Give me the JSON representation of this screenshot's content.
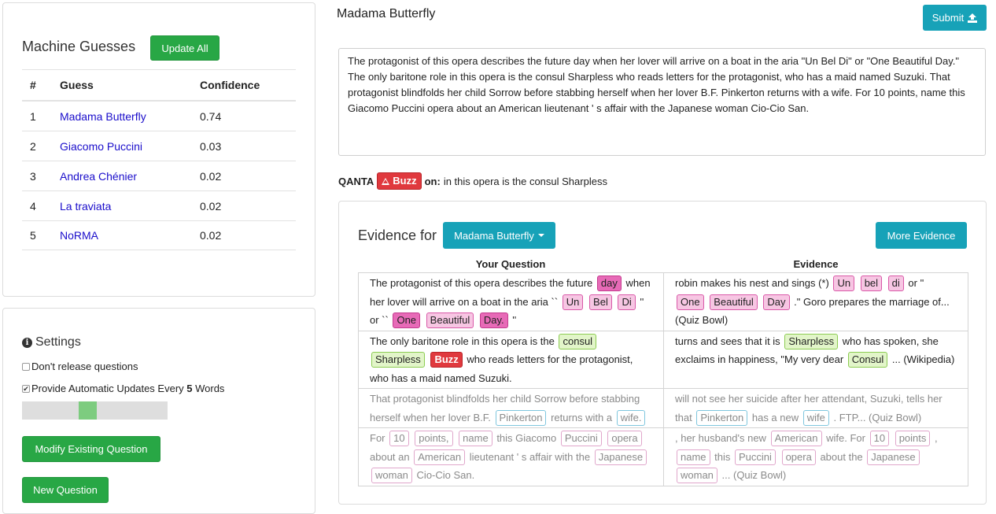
{
  "guesses": {
    "title": "Machine Guesses",
    "update_all_label": "Update All",
    "headers": [
      "#",
      "Guess",
      "Confidence"
    ],
    "rows": [
      {
        "num": "1",
        "guess": "Madama Butterfly",
        "confidence": "0.74"
      },
      {
        "num": "2",
        "guess": "Giacomo Puccini",
        "confidence": "0.03"
      },
      {
        "num": "3",
        "guess": "Andrea Chénier",
        "confidence": "0.02"
      },
      {
        "num": "4",
        "guess": "La traviata",
        "confidence": "0.02"
      },
      {
        "num": "5",
        "guess": "NoRMA",
        "confidence": "0.02"
      }
    ]
  },
  "settings": {
    "title": "Settings",
    "dont_release": "Don't release questions",
    "auto_update_prefix": "Provide Automatic Updates Every ",
    "auto_update_count": "5",
    "auto_update_suffix": " Words",
    "modify_label": "Modify Existing Question",
    "new_label": "New Question"
  },
  "question": {
    "answer": "Madama Butterfly",
    "submit_label": "Submit",
    "text": "The protagonist of this opera describes the future day when her lover will arrive on a boat in the aria \"Un Bel Di\" or \"One Beautiful Day.\" The only baritone role in this opera is the consul Sharpless who reads letters for the protagonist, who has a maid named Suzuki. That protagonist blindfolds her child Sorrow before stabbing herself when her lover B.F. Pinkerton returns with a wife. For 10 points, name this Giacomo Puccini opera about an American lieutenant ' s affair with the Japanese woman Cio-Cio San."
  },
  "buzz": {
    "agent": "QANTA",
    "button": "Buzz",
    "on_label": "on:",
    "phrase": "in this opera is the consul Sharpless"
  },
  "evidence": {
    "label": "Evidence for",
    "dropdown_value": "Madama Butterfly",
    "more_label": "More Evidence",
    "col_question": "Your Question",
    "col_evidence": "Evidence",
    "rows": [
      {
        "dim": false,
        "q": [
          [
            "The protagonist of this opera describes the future",
            ""
          ],
          [
            "day",
            "hpink"
          ],
          [
            "when her lover will arrive on a boat in the aria ``",
            ""
          ],
          [
            "Un",
            "pink"
          ],
          [
            "Bel",
            "pink"
          ],
          [
            "Di",
            "pink"
          ],
          [
            "'' or ``",
            ""
          ],
          [
            "One",
            "hpink"
          ],
          [
            "Beautiful",
            "pink"
          ],
          [
            "Day.",
            "hpink"
          ],
          [
            "''",
            ""
          ]
        ],
        "e": [
          [
            "robin makes his nest and sings (*)",
            ""
          ],
          [
            "Un",
            "pink"
          ],
          [
            "bel",
            "pink"
          ],
          [
            "di",
            "pink"
          ],
          [
            "or \"",
            ""
          ],
          [
            "One",
            "pink"
          ],
          [
            "Beautiful",
            "pink"
          ],
          [
            "Day",
            "pink"
          ],
          [
            ".\" Goro prepares the marriage of... (Quiz Bowl)",
            ""
          ]
        ]
      },
      {
        "dim": false,
        "q": [
          [
            "The only baritone role in this opera is the",
            ""
          ],
          [
            "consul",
            "green"
          ],
          [
            "Sharpless",
            "green"
          ],
          [
            "Buzz",
            "buzz2"
          ],
          [
            "who reads letters for the protagonist, who has a maid named Suzuki.",
            ""
          ]
        ],
        "e": [
          [
            "turns and sees that it is",
            ""
          ],
          [
            "Sharpless",
            "green"
          ],
          [
            "who has spoken, she exclaims in happiness, \"My very dear",
            ""
          ],
          [
            "Consul",
            "green"
          ],
          [
            "... (Wikipedia)",
            ""
          ]
        ]
      },
      {
        "dim": true,
        "q": [
          [
            "That protagonist blindfolds her child Sorrow before stabbing herself when her lover B.F.",
            ""
          ],
          [
            "Pinkerton",
            "blue"
          ],
          [
            "returns with a",
            ""
          ],
          [
            "wife.",
            "blue"
          ]
        ],
        "e": [
          [
            "will not see her suicide after her attendant, Suzuki, tells her that",
            ""
          ],
          [
            "Pinkerton",
            "blue"
          ],
          [
            "has a new",
            ""
          ],
          [
            "wife",
            "blue"
          ],
          [
            ". FTP... (Quiz Bowl)",
            ""
          ]
        ]
      },
      {
        "dim": true,
        "q": [
          [
            "For",
            ""
          ],
          [
            "10",
            "opink"
          ],
          [
            "points,",
            "opink"
          ],
          [
            "name",
            "opink"
          ],
          [
            "this Giacomo",
            ""
          ],
          [
            "Puccini",
            "opink"
          ],
          [
            "opera",
            "opink"
          ],
          [
            "about an",
            ""
          ],
          [
            "American",
            "opink"
          ],
          [
            "lieutenant ' s affair with the",
            ""
          ],
          [
            "Japanese",
            "opink"
          ],
          [
            "woman",
            "opink"
          ],
          [
            "Cio-Cio San.",
            ""
          ]
        ],
        "e": [
          [
            ", her husband's new",
            ""
          ],
          [
            "American",
            "opink"
          ],
          [
            "wife. For",
            ""
          ],
          [
            "10",
            "opink"
          ],
          [
            "points",
            "opink"
          ],
          [
            ",",
            ""
          ],
          [
            "name",
            "opink"
          ],
          [
            "this",
            ""
          ],
          [
            "Puccini",
            "opink"
          ],
          [
            "opera",
            "opink"
          ],
          [
            "about the",
            ""
          ],
          [
            "Japanese",
            "opink"
          ],
          [
            "woman",
            "opink"
          ],
          [
            "... (Quiz Bowl)",
            ""
          ]
        ]
      }
    ]
  }
}
